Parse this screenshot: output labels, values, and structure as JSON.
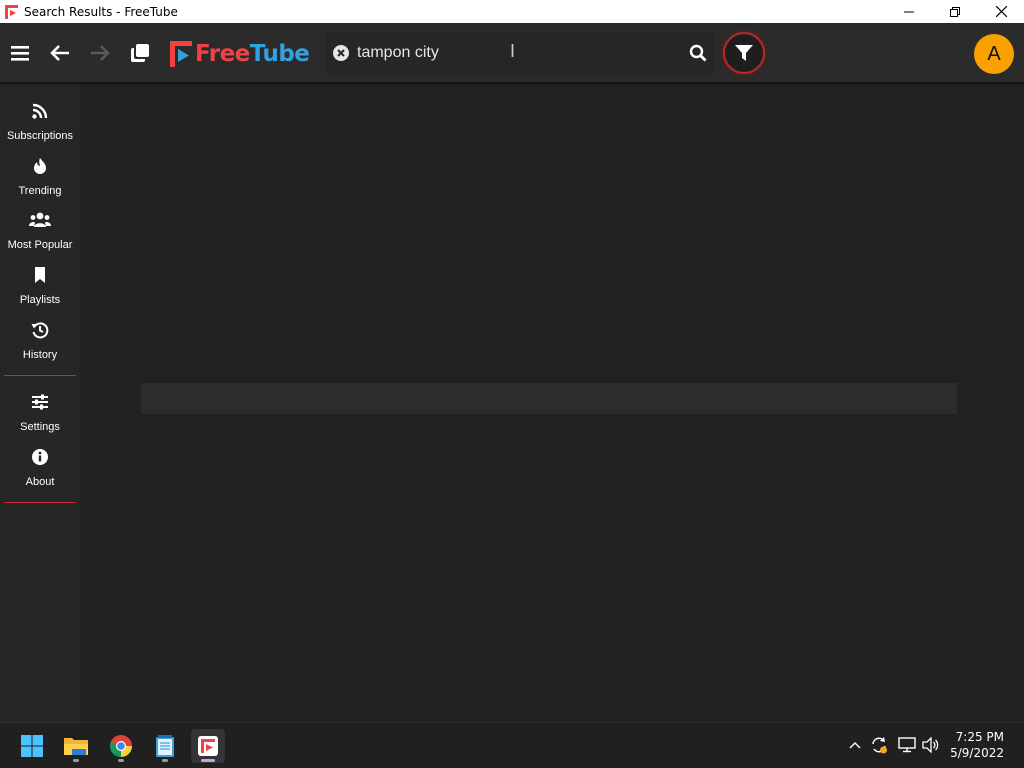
{
  "window": {
    "title": "Search Results - FreeTube"
  },
  "topnav": {
    "logo_free": "Free",
    "logo_tube": "Tube",
    "search": {
      "value": "tampon city",
      "placeholder": ""
    },
    "avatar_letter": "A"
  },
  "sidebar": {
    "items": [
      {
        "label": "Subscriptions",
        "icon": "rss-icon"
      },
      {
        "label": "Trending",
        "icon": "fire-icon"
      },
      {
        "label": "Most Popular",
        "icon": "users-icon"
      },
      {
        "label": "Playlists",
        "icon": "bookmark-icon"
      },
      {
        "label": "History",
        "icon": "history-icon"
      },
      {
        "label": "Settings",
        "icon": "sliders-icon"
      },
      {
        "label": "About",
        "icon": "info-icon"
      }
    ]
  },
  "taskbar": {
    "time": "7:25 PM",
    "date": "5/9/2022"
  },
  "colors": {
    "accent_red": "#f04242",
    "accent_blue": "#33a0df",
    "avatar_bg": "#f9a100",
    "background": "#212121"
  }
}
